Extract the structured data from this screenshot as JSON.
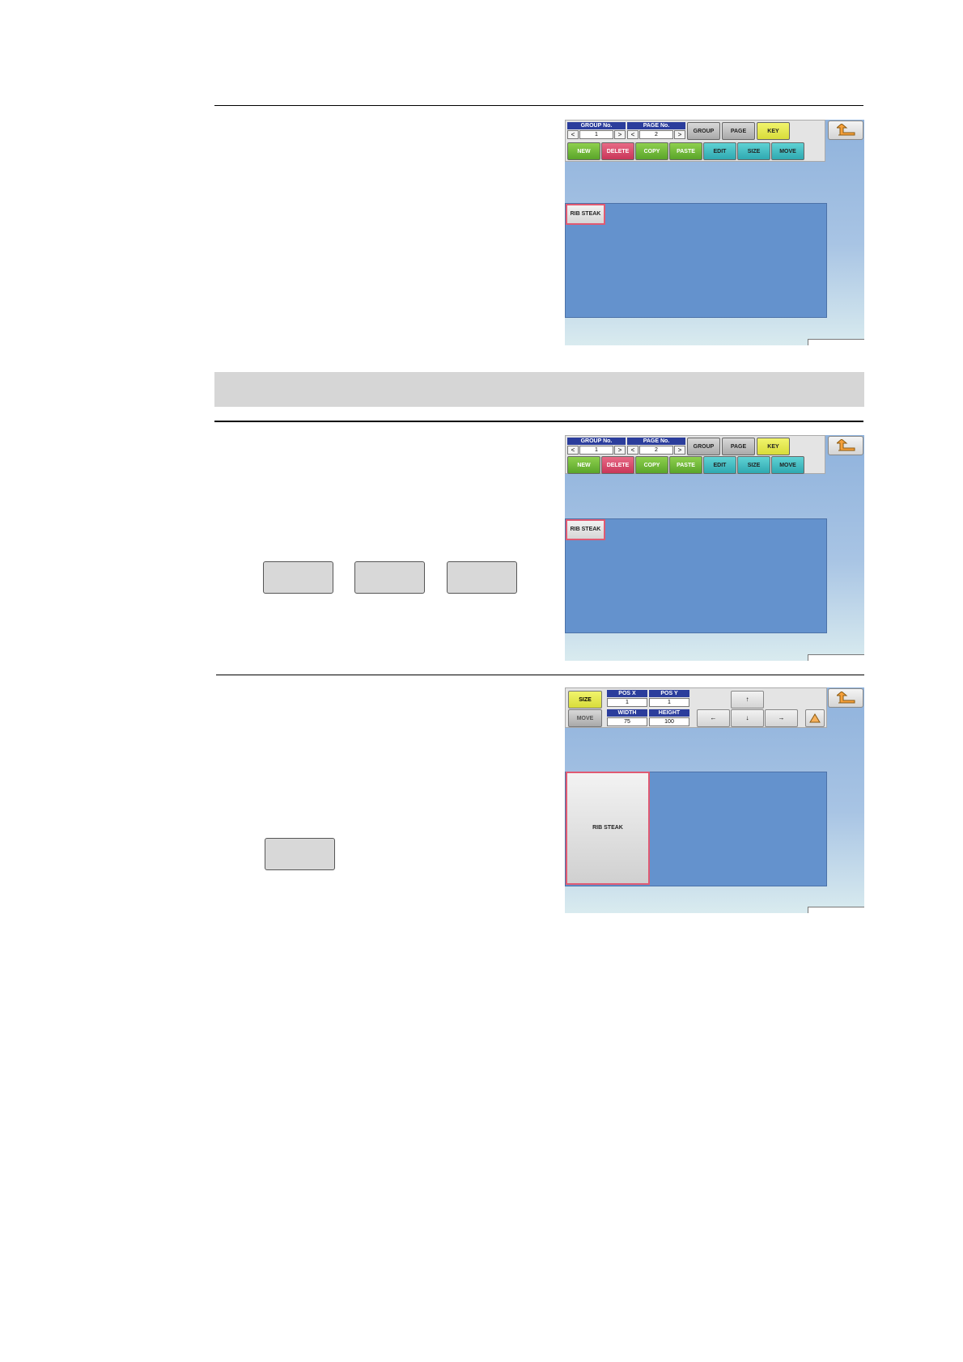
{
  "screen1": {
    "group_label": "GROUP No.",
    "group_value": "1",
    "page_label": "PAGE No.",
    "page_value": "2",
    "arrow_left": "<",
    "arrow_right": ">",
    "btn_group": "GROUP",
    "btn_page": "PAGE",
    "btn_key": "KEY",
    "btn_new": "NEW",
    "btn_delete": "DELETE",
    "btn_copy": "COPY",
    "btn_paste": "PASTE",
    "btn_edit": "EDIT",
    "btn_size": "SIZE",
    "btn_move": "MOVE",
    "key_label": "RIB STEAK"
  },
  "screen2": {
    "group_label": "GROUP No.",
    "group_value": "1",
    "page_label": "PAGE No.",
    "page_value": "2",
    "arrow_left": "<",
    "arrow_right": ">",
    "btn_group": "GROUP",
    "btn_page": "PAGE",
    "btn_key": "KEY",
    "btn_new": "NEW",
    "btn_delete": "DELETE",
    "btn_copy": "COPY",
    "btn_paste": "PASTE",
    "btn_edit": "EDIT",
    "btn_size": "SIZE",
    "btn_move": "MOVE",
    "key_label": "RIB STEAK"
  },
  "screen3": {
    "btn_size": "SIZE",
    "btn_move": "MOVE",
    "pos_x_label": "POS X",
    "pos_x_value": "1",
    "pos_y_label": "POS Y",
    "pos_y_value": "1",
    "width_label": "WIDTH",
    "width_value": "75",
    "height_label": "HEIGHT",
    "height_value": "100",
    "up_arrow": "↑",
    "down_arrow": "↓",
    "left_arrow": "←",
    "right_arrow": "→",
    "key_label": "RIB STEAK"
  },
  "colors": {
    "toolbar_label_bg": "#2b3d9c",
    "key_yellow": "#e3e64a",
    "new_green": "#6cb83a",
    "delete_red": "#d9466a",
    "edit_cyan": "#3dbbc0",
    "panel_blue": "#6492cd",
    "key_border": "#e05a72"
  }
}
